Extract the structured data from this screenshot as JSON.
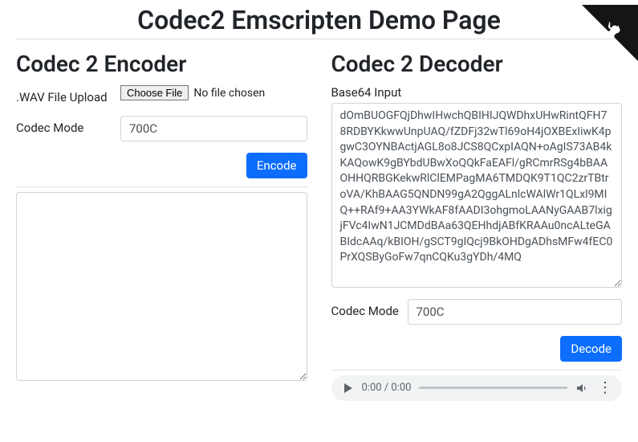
{
  "page": {
    "title": "Codec2 Emscripten Demo Page"
  },
  "encoder": {
    "title": "Codec 2 Encoder",
    "upload_label": ".WAV File Upload",
    "file_button": "Choose File",
    "file_status": "No file chosen",
    "mode_label": "Codec Mode",
    "mode_value": "700C",
    "encode_button": "Encode",
    "output": ""
  },
  "decoder": {
    "title": "Codec 2 Decoder",
    "input_label": "Base64 Input",
    "input_value": "dOmBUOGFQjDhwIHwchQBIHIJQWDhxUHwRintQFH78RDBYKkwwUnpUAQ/fZDFj32wTl69oH4jOXBExIiwK4pgwC3OYNBActjAGL8o8JCS8QCxpIAQN+oAgIS73AB4kKAQowK9gBYbdUBwXoQQkFaEAFl/gRCmrRSg4bBAAOHHQRBGKekwRlClEMPagMA6TMDQK9T1QC2zrTBtroVA/KhBAAG5QNDN99gA2QggALnlcWAlWr1QLxl9MIQ++RAf9+AA3YWkAF8fAADI3ohgmoLAANyGAAB7lxigjFVc4IwN1JCMDdBAa63QEHhdjABfKRAAu0ncALteGABIdcAAq/kBIOH/gSCT9gIQcj9BkOHDgADhsMFw4fEC0PrXQSByGoFw7qnCQKu3gYDh/4MQ",
    "mode_label": "Codec Mode",
    "mode_value": "700C",
    "decode_button": "Decode",
    "audio": {
      "time": "0:00 / 0:00"
    }
  }
}
